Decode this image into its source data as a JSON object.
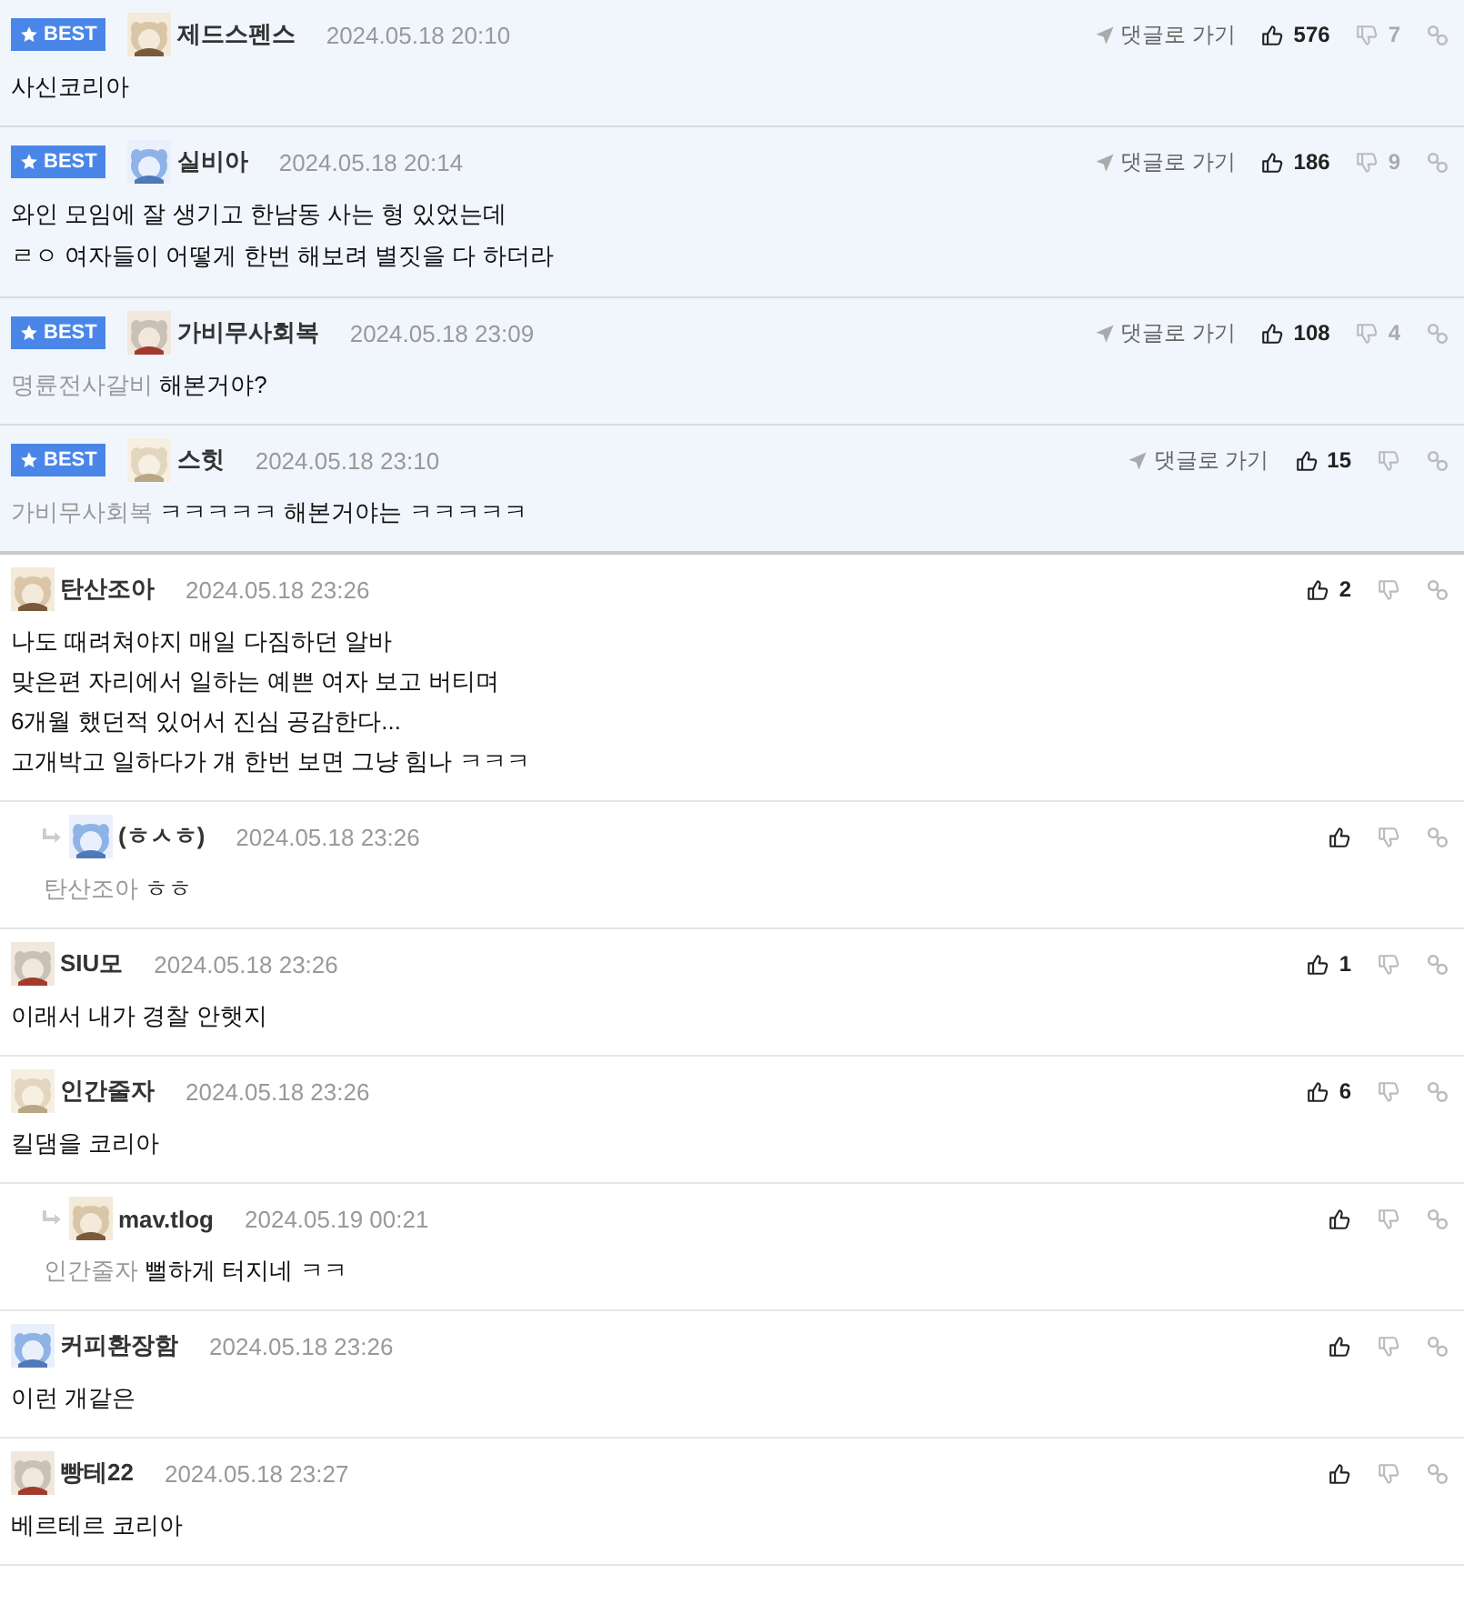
{
  "comments": [
    {
      "kind": "comment",
      "best": true,
      "badge": "BEST",
      "author": "제드스펜스",
      "time": "2024.05.18 20:10",
      "goto": "댓글로 가기",
      "likes": "576",
      "dislikes": "7",
      "lines": [
        "사신코리아"
      ]
    },
    {
      "kind": "comment",
      "best": true,
      "badge": "BEST",
      "author": "실비아",
      "time": "2024.05.18 20:14",
      "goto": "댓글로 가기",
      "likes": "186",
      "dislikes": "9",
      "lines": [
        "와인 모임에 잘 생기고 한남동 사는 형 있었는데",
        "ㄹㅇ 여자들이 어떻게 한번 해보려 별짓을 다 하더라"
      ]
    },
    {
      "kind": "comment",
      "best": true,
      "badge": "BEST",
      "author": "가비무사회복",
      "time": "2024.05.18 23:09",
      "goto": "댓글로 가기",
      "likes": "108",
      "dislikes": "4",
      "mention": "명륜전사갈비",
      "lines": [
        "해본거야?"
      ]
    },
    {
      "kind": "comment",
      "best": true,
      "badge": "BEST",
      "author": "스힛",
      "time": "2024.05.18 23:10",
      "goto": "댓글로 가기",
      "likes": "15",
      "mention": "가비무사회복",
      "lines": [
        "ㅋㅋㅋㅋㅋ 해본거야는 ㅋㅋㅋㅋㅋ"
      ]
    },
    {
      "kind": "comment",
      "best": false,
      "author": "탄산조아",
      "time": "2024.05.18 23:26",
      "likes": "2",
      "lines": [
        "나도 때려쳐야지 매일 다짐하던 알바",
        "맞은편 자리에서 일하는 예쁜 여자 보고 버티며",
        "6개월 했던적 있어서 진심 공감한다...",
        "고개박고 일하다가 걔 한번 보면 그냥 힘나 ㅋㅋㅋ"
      ]
    },
    {
      "kind": "reply",
      "best": false,
      "author": "(ㅎㅅㅎ)",
      "time": "2024.05.18 23:26",
      "mention": "탄산조아",
      "lines": [
        "ㅎㅎ"
      ]
    },
    {
      "kind": "comment",
      "best": false,
      "author": "SIU모",
      "time": "2024.05.18 23:26",
      "likes": "1",
      "lines": [
        "이래서 내가 경찰 안햇지"
      ]
    },
    {
      "kind": "comment",
      "best": false,
      "author": "인간줄자",
      "time": "2024.05.18 23:26",
      "likes": "6",
      "lines": [
        "킬댐을 코리아"
      ]
    },
    {
      "kind": "reply",
      "best": false,
      "author": "mav.tlog",
      "time": "2024.05.19 00:21",
      "mention": "인간줄자",
      "lines": [
        "뻘하게 터지네 ㅋㅋ"
      ]
    },
    {
      "kind": "comment",
      "best": false,
      "author": "커피환장함",
      "time": "2024.05.18 23:26",
      "lines": [
        "이런 개같은"
      ]
    },
    {
      "kind": "comment",
      "best": false,
      "author": "빵테22",
      "time": "2024.05.18 23:27",
      "lines": [
        "베르테르 코리아"
      ]
    }
  ]
}
